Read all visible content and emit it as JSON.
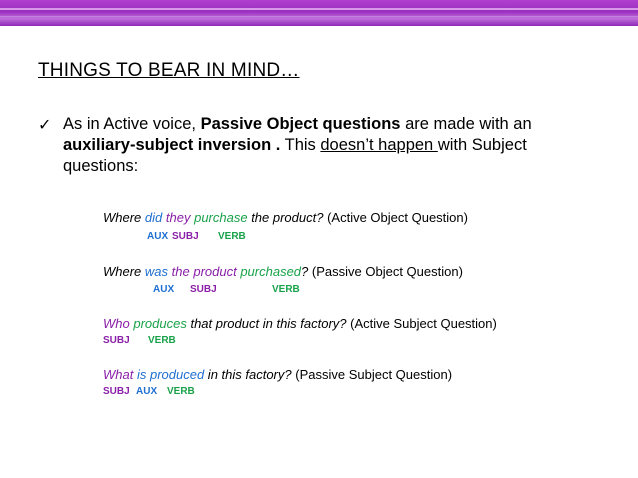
{
  "slide": {
    "title": "THINGS TO BEAR IN MIND…",
    "bullet": {
      "check": "✓",
      "t1": "As in Active voice, ",
      "t2": "Passive Object questions",
      "t3": " are made with an ",
      "t4": "auxiliary-subject inversion .",
      "t5": " This ",
      "t6": "doesn’t happen ",
      "t7": "with Subject questions:"
    },
    "examples": [
      {
        "parts": [
          "Where ",
          "did",
          " ",
          "they",
          " ",
          "purchase",
          " the product?",
          " (Active Object Question)"
        ],
        "labels": [
          "AUX",
          "SUBJ",
          "VERB"
        ]
      },
      {
        "parts": [
          "Where ",
          "was",
          " ",
          "the product",
          " ",
          "purchased",
          "?",
          " (Passive Object Question)"
        ],
        "labels": [
          "AUX",
          "SUBJ",
          "VERB"
        ]
      },
      {
        "parts": [
          "Who",
          " ",
          "produces",
          " that product in this factory?",
          " (Active Subject Question)"
        ],
        "labels": [
          "SUBJ",
          "VERB"
        ]
      },
      {
        "parts": [
          "What",
          " ",
          "is produced",
          " in this factory?",
          " (Passive Subject Question)"
        ],
        "labels": [
          "SUBJ",
          "AUX",
          "VERB"
        ]
      }
    ],
    "colors": {
      "aux": "#1f6fd1",
      "subj": "#8a1fa8",
      "verb": "#1aa24a",
      "bar": "#9a2fc0"
    }
  }
}
